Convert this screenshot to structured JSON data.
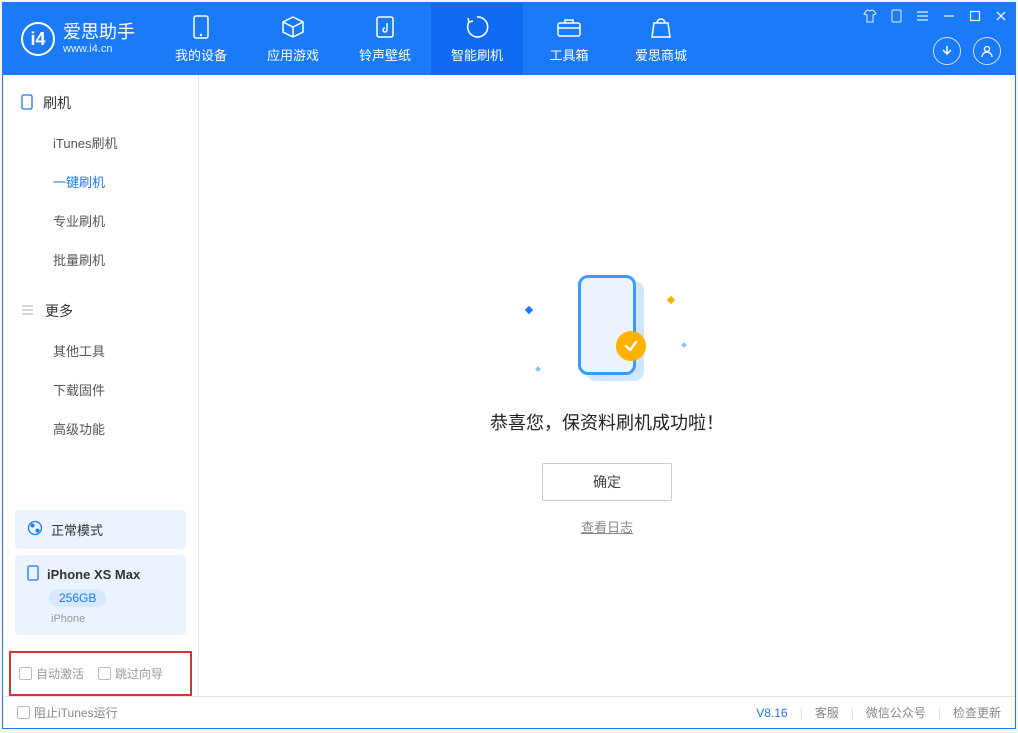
{
  "app": {
    "title": "爱思助手",
    "subtitle": "www.i4.cn"
  },
  "nav": {
    "tabs": [
      {
        "label": "我的设备"
      },
      {
        "label": "应用游戏"
      },
      {
        "label": "铃声壁纸"
      },
      {
        "label": "智能刷机"
      },
      {
        "label": "工具箱"
      },
      {
        "label": "爱思商城"
      }
    ]
  },
  "sidebar": {
    "section1": {
      "title": "刷机",
      "items": [
        {
          "label": "iTunes刷机"
        },
        {
          "label": "一键刷机"
        },
        {
          "label": "专业刷机"
        },
        {
          "label": "批量刷机"
        }
      ]
    },
    "section2": {
      "title": "更多",
      "items": [
        {
          "label": "其他工具"
        },
        {
          "label": "下载固件"
        },
        {
          "label": "高级功能"
        }
      ]
    },
    "device": {
      "mode": "正常模式",
      "name": "iPhone XS Max",
      "capacity": "256GB",
      "type": "iPhone"
    },
    "checks": {
      "auto_activate": "自动激活",
      "skip_guide": "跳过向导"
    }
  },
  "main": {
    "success": "恭喜您，保资料刷机成功啦！",
    "ok": "确定",
    "log": "查看日志"
  },
  "footer": {
    "block_itunes": "阻止iTunes运行",
    "version": "V8.16",
    "support": "客服",
    "wechat": "微信公众号",
    "update": "检查更新"
  }
}
